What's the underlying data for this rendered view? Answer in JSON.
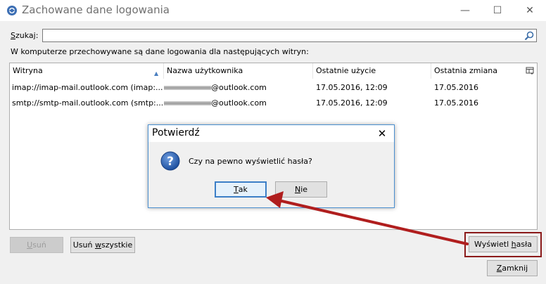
{
  "window": {
    "title": "Zachowane dane logowania",
    "min_symbol": "—",
    "max_symbol": "☐",
    "close_symbol": "✕"
  },
  "search": {
    "label_u": "S",
    "label_rest": "zukaj:",
    "value": "",
    "placeholder": ""
  },
  "info_text": "W komputerze przechowywane są dane logowania dla następujących witryn:",
  "table": {
    "columns": [
      "Witryna",
      "Nazwa użytkownika",
      "Ostatnie użycie",
      "Ostatnia zmiana"
    ],
    "sort_indicator": "▲",
    "rows": [
      {
        "site": "imap://imap-mail.outlook.com (imap:...",
        "user": "@outlook.com",
        "last_used": "17.05.2016, 12:09",
        "changed": "17.05.2016"
      },
      {
        "site": "smtp://smtp-mail.outlook.com (smtp:...",
        "user": "@outlook.com",
        "last_used": "17.05.2016, 12:09",
        "changed": "17.05.2016"
      }
    ]
  },
  "buttons": {
    "remove_u": "U",
    "remove_rest": "suń",
    "remove_all_pre": "Usuń ",
    "remove_all_u": "w",
    "remove_all_rest": "szystkie",
    "show_pre": "Wyświetl ",
    "show_u": "h",
    "show_rest": "asła",
    "close_u": "Z",
    "close_rest": "amknij"
  },
  "dialog": {
    "title": "Potwierdź",
    "close_symbol": "✕",
    "message": "Czy na pewno wyświetlić hasła?",
    "yes_u": "T",
    "yes_rest": "ak",
    "no_u": "N",
    "no_rest": "ie"
  },
  "colors": {
    "highlight": "#8b1a1a",
    "arrow": "#b01e1e",
    "dialog_border": "#4a8fd0",
    "question_icon": "#2a5db0"
  }
}
